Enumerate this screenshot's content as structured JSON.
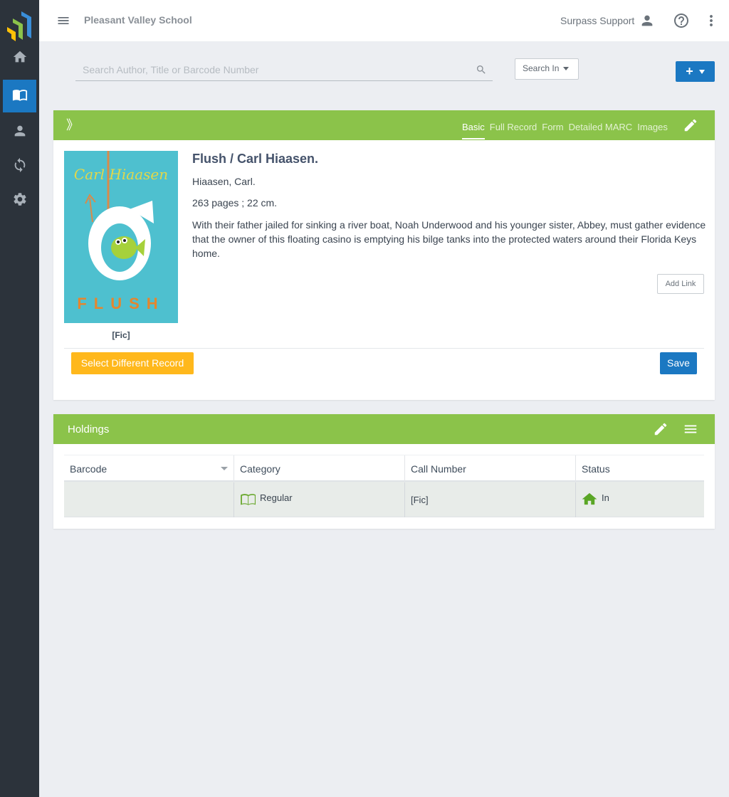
{
  "topbar": {
    "school_name": "Pleasant Valley School",
    "user_name": "Surpass Support"
  },
  "search": {
    "placeholder": "Search Author, Title or Barcode Number",
    "value": "",
    "search_in_label": "Search In",
    "add_label": "+"
  },
  "record": {
    "tabs": [
      {
        "label": "Basic",
        "active": true
      },
      {
        "label": "Full Record",
        "active": false
      },
      {
        "label": "Form",
        "active": false
      },
      {
        "label": "Detailed MARC",
        "active": false
      },
      {
        "label": "Images",
        "active": false
      }
    ],
    "title": "Flush / Carl Hiaasen.",
    "author": "Hiaasen, Carl.",
    "pages": "263 pages ; 22 cm.",
    "summary": "With their father jailed for sinking a river boat, Noah Underwood and his younger sister, Abbey, must gather evidence that the owner of this floating casino is emptying his bilge tanks into the protected waters around their Florida Keys home.",
    "cover": {
      "author_text": "Carl Hiaasen",
      "title_text": "FLUSH",
      "bg_color": "#4ec0cf"
    },
    "cover_call_number": "[Fic]",
    "add_link_label": "Add Link",
    "select_different_label": "Select Different Record",
    "save_label": "Save"
  },
  "holdings": {
    "title": "Holdings",
    "columns": [
      "Barcode",
      "Category",
      "Call Number",
      "Status"
    ],
    "rows": [
      {
        "barcode": "",
        "category": "Regular",
        "call_number": "[Fic]",
        "status": "In"
      }
    ]
  },
  "colors": {
    "sidebar": "#2c333b",
    "accent_blue": "#1b78c2",
    "green_bar": "#8bc34a",
    "yellow_button": "#ffb81c"
  },
  "icons": {
    "sidebar": [
      "home-icon",
      "book-icon",
      "person-icon",
      "sync-icon",
      "gear-icon"
    ],
    "topbar": [
      "menu-icon",
      "account-icon",
      "help-icon",
      "more-vert-icon"
    ]
  }
}
